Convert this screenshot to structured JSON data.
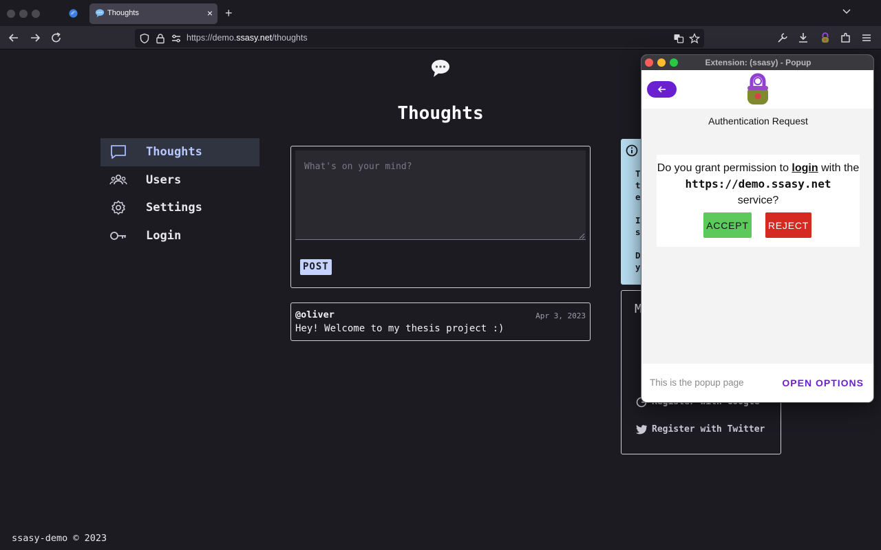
{
  "browser": {
    "tab": {
      "title": "Thoughts",
      "close": "×"
    },
    "new_tab": "+",
    "url": {
      "prefix": "https://demo.",
      "domain": "ssasy.net",
      "path": "/thoughts"
    }
  },
  "page": {
    "title": "Thoughts",
    "nav": [
      {
        "label": "Thoughts",
        "icon": "chat-bubble-icon",
        "active": true
      },
      {
        "label": "Users",
        "icon": "users-icon",
        "active": false
      },
      {
        "label": "Settings",
        "icon": "gear-icon",
        "active": false
      },
      {
        "label": "Login",
        "icon": "key-icon",
        "active": false
      }
    ],
    "compose": {
      "placeholder": "What's on your mind?",
      "post_label": "POST"
    },
    "posts": [
      {
        "author": "@oliver",
        "date": "Apr 3, 2023",
        "body": "Hey! Welcome to my thesis project :)"
      }
    ],
    "info_box": {
      "visible_chars": [
        "T",
        "t",
        "e",
        "I",
        "s",
        "D",
        "y"
      ]
    },
    "register_box": {
      "heading_letter": "M",
      "items": [
        {
          "label": "Register with Google",
          "icon": "google-icon"
        },
        {
          "label": "Register with Twitter",
          "icon": "twitter-icon"
        }
      ]
    },
    "footer": "ssasy-demo © 2023"
  },
  "popup": {
    "window_title": "Extension: (ssasy) - Popup",
    "heading": "Authentication Request",
    "question": {
      "part1": "Do you grant permission to ",
      "action": "login",
      "part2": " with the ",
      "service_url": "https://demo.ssasy.net",
      "part3": " service?"
    },
    "accept_label": "ACCEPT",
    "reject_label": "REJECT",
    "footer_text": "This is the popup page",
    "options_label": "OPEN OPTIONS",
    "colors": {
      "accent": "#6a1fd0",
      "accept": "#5bc95b",
      "reject": "#d42a22"
    }
  }
}
